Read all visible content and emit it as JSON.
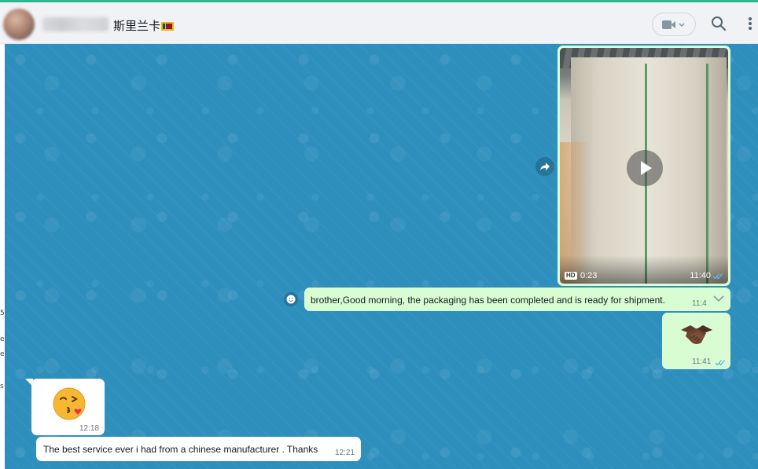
{
  "header": {
    "contact_name": "斯里兰卡",
    "flag_icon": "flag-sri-lanka-icon",
    "video_call_icon": "video-camera-icon",
    "search_icon": "search-icon",
    "menu_icon": "kebab-menu-icon"
  },
  "left_edge_text": [
    "5",
    "er",
    "e",
    "s"
  ],
  "messages": {
    "video": {
      "hd_label": "HD",
      "duration": "0:23",
      "time": "11:40"
    },
    "outgoing_text": {
      "text": "brother,Good morning, the packaging has been completed and is ready for shipment.",
      "time": "11:4"
    },
    "outgoing_sticker": {
      "emoji_icon": "handshake-emoji-icon",
      "time": "11:41"
    },
    "incoming_sticker": {
      "emoji_icon": "face-blowing-kiss-emoji-icon",
      "time": "12:18"
    },
    "incoming_text": {
      "text": "The best service ever i had from  a chinese manufacturer . Thanks",
      "time": "12:21"
    }
  },
  "colors": {
    "wallpaper": "#2e8fbd",
    "outgoing_bubble": "#d9fdd3",
    "incoming_bubble": "#ffffff",
    "read_ticks": "#53bdeb",
    "accent": "#2fb58f"
  }
}
